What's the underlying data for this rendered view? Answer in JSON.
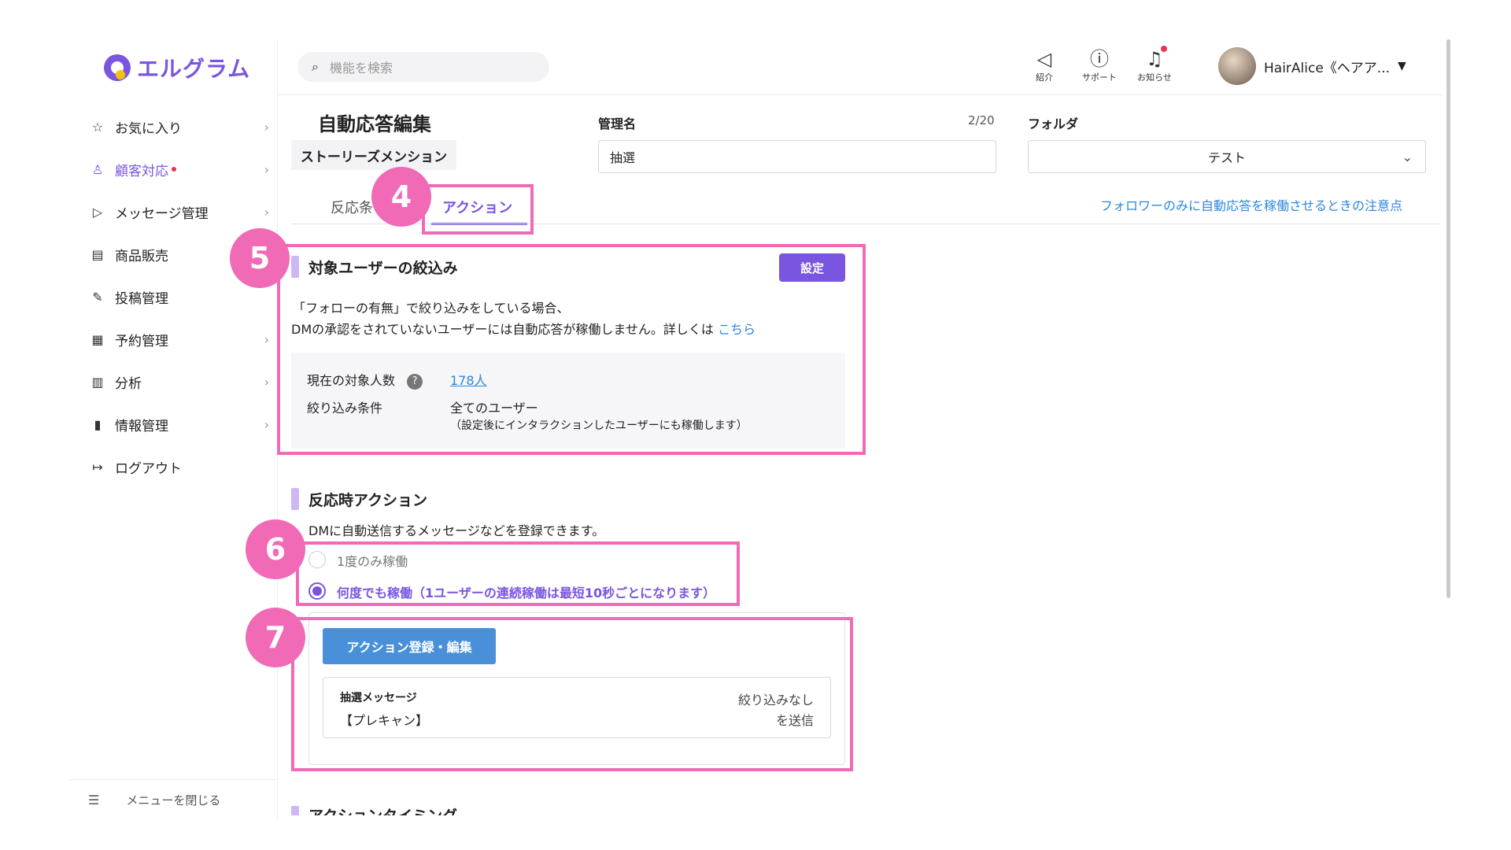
{
  "brand": {
    "name": "エルグラム"
  },
  "sidebar": {
    "items": [
      {
        "label": "お気に入り",
        "icon": "☆"
      },
      {
        "label": "顧客対応",
        "icon": "♙"
      },
      {
        "label": "メッセージ管理",
        "icon": "▷"
      },
      {
        "label": "商品販売",
        "icon": "▤"
      },
      {
        "label": "投稿管理",
        "icon": "✎"
      },
      {
        "label": "予約管理",
        "icon": "▦"
      },
      {
        "label": "分析",
        "icon": "▥"
      },
      {
        "label": "情報管理",
        "icon": "▮"
      },
      {
        "label": "ログアウト",
        "icon": "↦"
      }
    ],
    "close_label": "メニューを閉じる"
  },
  "header": {
    "search_placeholder": "機能を検索",
    "icons": [
      {
        "label": "紹介"
      },
      {
        "label": "サポート"
      },
      {
        "label": "お知らせ"
      }
    ],
    "user_name": "HairAlice《ヘアア..."
  },
  "form": {
    "title": "自動応答編集",
    "type_chip": "ストーリーズメンション",
    "name_label": "管理名",
    "name_counter": "2/20",
    "name_value": "抽選",
    "folder_label": "フォルダ",
    "folder_value": "テスト"
  },
  "tabs": {
    "inactive": "反応条",
    "active": "アクション",
    "link": "フォロワーのみに自動応答を稼働させるときの注意点"
  },
  "target": {
    "title": "対象ユーザーの絞込み",
    "button": "設定",
    "note_line1": "「フォローの有無」で絞り込みをしている場合、",
    "note_line2": "DMの承認をされていないユーザーには自動応答が稼働しません。詳しくは",
    "note_link": "こちら",
    "count_label": "現在の対象人数",
    "count_value": "178人",
    "cond_label": "絞り込み条件",
    "cond_value": "全てのユーザー",
    "cond_note": "（設定後にインタラクションしたユーザーにも稼働します）"
  },
  "reaction": {
    "title": "反応時アクション",
    "desc": "DMに自動送信するメッセージなどを登録できます。",
    "opt_once": "1度のみ稼働",
    "opt_many": "何度でも稼働（1ユーザーの連続稼働は最短10秒ごとになります）",
    "action_button": "アクション登録・編集",
    "msg_title": "抽選メッセージ",
    "msg_sub": "【プレキャン】",
    "msg_right1": "絞り込みなし",
    "msg_right2": "を送信"
  },
  "next_section": {
    "title": "アクションタイミング"
  },
  "annotations": {
    "b4": "4",
    "b5": "5",
    "b6": "6",
    "b7": "7"
  },
  "colors": {
    "accent": "#7a55e0",
    "highlight": "#f06ab6",
    "link": "#2e86de",
    "button_blue": "#4a90d9"
  }
}
